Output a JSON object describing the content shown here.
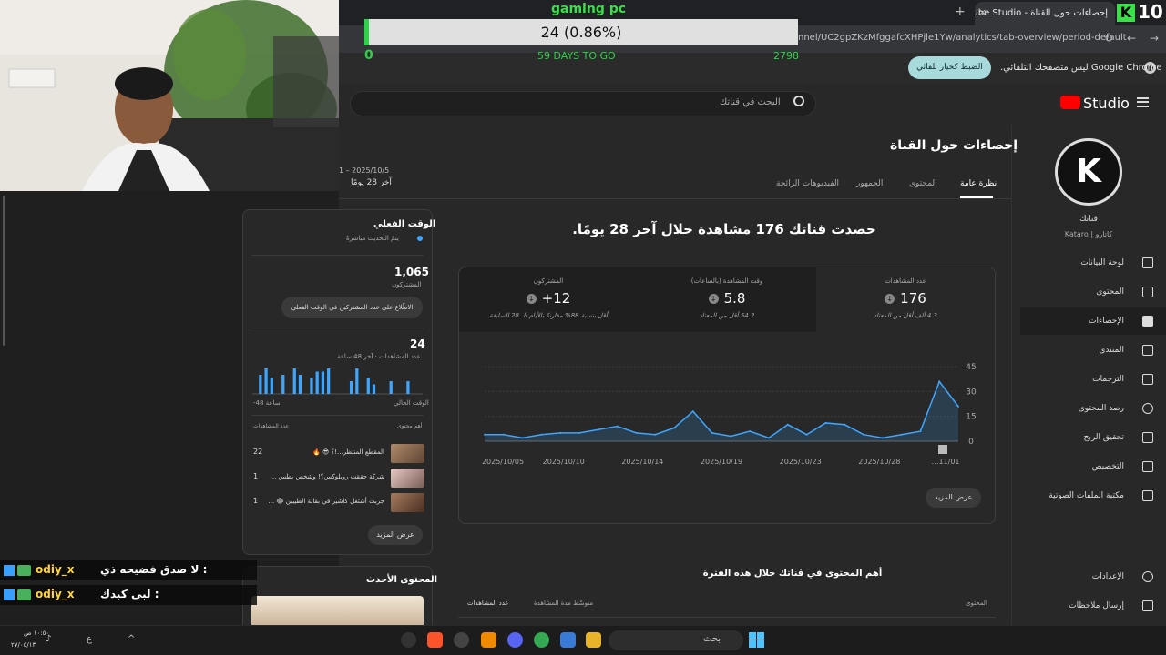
{
  "browser": {
    "tab_title": "إحصاءات حول القناة - YouTube Studio",
    "url": "nnel/UC2gpZKzMfggafcXHPjle1Yw/analytics/tab-overview/period-default",
    "infobar_text": "Google Chrome ليس متصفحك التلقائي.",
    "infobar_button": "الضبط كخيار تلقائي",
    "new_tab_glyph": "+",
    "close_glyph": "×",
    "back_glyph": "←",
    "forward_glyph": "→",
    "reload_glyph": "↻"
  },
  "overlay": {
    "goal_title": "gaming pc",
    "goal_value": "24 (0.86%)",
    "goal_min": "0",
    "goal_days": "59 DAYS TO GO",
    "goal_max": "2798",
    "goal_progress": 0.0086,
    "counter_logo": "K",
    "counter_value": "10"
  },
  "studio": {
    "logo_text": "Studio",
    "search_placeholder": "البحث في قناتك"
  },
  "sidebar": {
    "channel_name": "قناتك",
    "channel_handle": "Kataro | كاتارو",
    "avatar_letter": "K",
    "items": [
      {
        "label": "لوحة البيانات"
      },
      {
        "label": "المحتوى"
      },
      {
        "label": "الإحصاءات"
      },
      {
        "label": "المنتدى"
      },
      {
        "label": "الترجمات"
      },
      {
        "label": "رصد المحتوى"
      },
      {
        "label": "تحقيق الربح"
      },
      {
        "label": "التخصيص"
      },
      {
        "label": "مكتبة الملفات الصوتية"
      }
    ],
    "settings": "الإعدادات",
    "feedback": "إرسال ملاحظات"
  },
  "main": {
    "page_title": "إحصاءات حول القناة",
    "tabs": [
      {
        "label": "نظرة عامة"
      },
      {
        "label": "المحتوى"
      },
      {
        "label": "الجمهور"
      },
      {
        "label": "الفيديوهات الرائجة"
      }
    ],
    "date_range": "1 – 2025/10/5",
    "date_label": "آخر 28 يومًا",
    "headline": "حصدت قناتك 176 مشاهدة خلال آخر 28 يومًا.",
    "metrics": [
      {
        "label": "عدد المشاهدات",
        "value": "176",
        "sub": "4.3 ألف أقل من المعتاد"
      },
      {
        "label": "وقت المشاهدة (بالساعات)",
        "value": "5.8",
        "sub": "54.2 أقل من المعتاد"
      },
      {
        "label": "المشتركون",
        "value": "+12",
        "sub": "أقل بنسبة 88% مقارنةً بالأيام الـ 28 السابقة"
      }
    ],
    "more_button": "عرض المزيد",
    "top_content_title": "أهم المحتوى في قناتك خلال هذه الفترة",
    "top_content_headers": [
      "المحتوى",
      "متوسّط مدة المشاهدة",
      "عدد المشاهدات"
    ]
  },
  "chart_data": {
    "type": "line",
    "x": [
      "2025/10/05",
      "2025/10/10",
      "2025/10/14",
      "2025/10/19",
      "2025/10/23",
      "2025/10/28",
      "2025/11/01"
    ],
    "x_tick_labels": [
      "2025/10/05",
      "2025/10/10",
      "2025/10/14",
      "2025/10/19",
      "2025/10/23",
      "2025/10/28",
      "…11/01"
    ],
    "y_ticks": [
      "45",
      "30",
      "15",
      "0"
    ],
    "ylim": [
      0,
      45
    ],
    "values": [
      4,
      4,
      2,
      4,
      5,
      5,
      7,
      9,
      5,
      4,
      8,
      18,
      5,
      3,
      6,
      2,
      10,
      4,
      11,
      10,
      4,
      2,
      4,
      6,
      36,
      21
    ],
    "color": "#3ea6ff",
    "grid": true
  },
  "realtime": {
    "title": "الوقت الفعلي",
    "sub": "يتمّ التحديث مباشرةً",
    "subscribers": "1,065",
    "subscribers_label": "المشتركون",
    "live_button": "الاطّلاع على عدد المشتركين في الوقت الفعلي",
    "views": "24",
    "views_label": "عدد المشاهدات · آخر 48 ساعة",
    "bars": [
      0,
      6,
      8,
      5,
      0,
      6,
      0,
      8,
      6,
      0,
      5,
      7,
      7,
      8,
      0,
      0,
      0,
      4,
      8,
      0,
      5,
      3,
      0,
      0,
      4,
      0,
      0,
      4,
      0,
      0
    ],
    "axis_left": "-48 ساعة",
    "axis_right": "الوقت الحالي",
    "col_content": "أهم محتوى",
    "col_views": "عدد المشاهدات",
    "rows": [
      {
        "title": "المقطع المنتظر...!؟ 😎 🔥",
        "views": "22"
      },
      {
        "title": "شركة حققت روبلوكس؟! وشخص بطس ...",
        "views": "1"
      },
      {
        "title": "جربت أشتغل كاشير في بقالة الطيبين 😂 ...",
        "views": "1"
      }
    ],
    "more_button": "عرض المزيد"
  },
  "latest": {
    "title": "المحتوى الأحدث"
  },
  "chat": [
    {
      "user": "odiy_x",
      "msg": ": لا صدق فضيحه ذي"
    },
    {
      "user": "odiy_x",
      "msg": ": لبى كبدك"
    }
  ],
  "taskbar": {
    "search": "بحث",
    "time": "١٠:٥٠ ص",
    "date": "٢٧/٠٥/١٣",
    "lang": "ع",
    "tray_up": "^"
  },
  "colors": {
    "accent": "#3ea6ff",
    "goal_green": "#2bd448",
    "bg": "#282828",
    "yt_red": "#ff0000"
  }
}
